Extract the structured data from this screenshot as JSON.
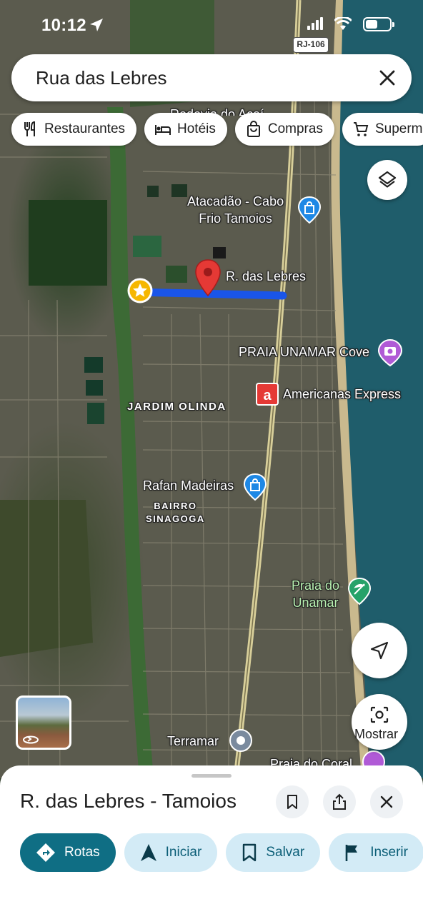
{
  "status_bar": {
    "time": "10:12"
  },
  "search": {
    "query": "Rua das Lebres"
  },
  "chips": [
    {
      "label": "Restaurantes",
      "icon": "restaurant-icon"
    },
    {
      "label": "Hotéis",
      "icon": "bed-icon"
    },
    {
      "label": "Compras",
      "icon": "shopping-bag-icon"
    },
    {
      "label": "Superm",
      "icon": "cart-icon"
    }
  ],
  "map": {
    "road_shield": "RJ-106",
    "labels": {
      "top_partial": "Rodovia do Açaí",
      "atacadao": "Atacadão - Cabo\nFrio Tamoios",
      "street": "R. das Lebres",
      "praia_unamar_cove": "PRAIA UNAMAR Cove",
      "americanas": "Americanas Express",
      "jardim_olinda": "JARDIM OLINDA",
      "rafan": "Rafan Madeiras",
      "bairro_sinagoga": "BAIRRO\nSINAGOGA",
      "praia_do_unamar": "Praia do\nUnamar",
      "terramar": "Terramar",
      "praia_do_coral": "Praia do Coral"
    },
    "lens_label": "Mostrar",
    "colors": {
      "route": "#1a55e8",
      "pin": "#e53935",
      "poi_blue": "#1e88e5",
      "poi_purple": "#b05ad6",
      "poi_green": "#26a269"
    }
  },
  "sheet": {
    "title": "R. das Lebres - Tamoios",
    "actions": [
      {
        "label": "Rotas",
        "icon": "directions-icon"
      },
      {
        "label": "Iniciar",
        "icon": "navigation-arrow-icon"
      },
      {
        "label": "Salvar",
        "icon": "bookmark-icon"
      },
      {
        "label": "Inserir",
        "icon": "flag-icon"
      }
    ]
  }
}
